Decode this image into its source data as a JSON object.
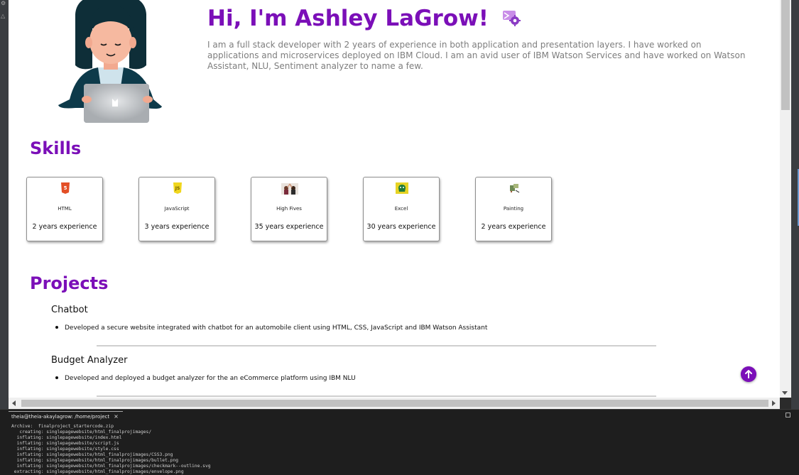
{
  "hero": {
    "title": "Hi, I'm Ashley LaGrow!",
    "description": "I am a full stack developer with 2 years of experience in both application and presentation layers. I have worked on applications and microservices deployed on IBM Cloud. I am an avid user of IBM Watson Services and have worked on Watson Assistant, NLU, Sentiment analyzer to name a few.",
    "title_icon": "envelope-gear-icon",
    "avatar_icon": "developer-avatar-illustration"
  },
  "skills": {
    "heading": "Skills",
    "items": [
      {
        "name": "HTML",
        "experience": "2 years experience",
        "icon": "html5-icon"
      },
      {
        "name": "JavaScript",
        "experience": "3 years experience",
        "icon": "javascript-icon"
      },
      {
        "name": "High Fives",
        "experience": "35 years experience",
        "icon": "high-fives-icon"
      },
      {
        "name": "Excel",
        "experience": "30 years experience",
        "icon": "excel-icon"
      },
      {
        "name": "Painting",
        "experience": "2 years experience",
        "icon": "painting-icon"
      }
    ]
  },
  "projects": {
    "heading": "Projects",
    "items": [
      {
        "title": "Chatbot",
        "bullet": "Developed a secure website integrated with chatbot for an automobile client using HTML, CSS, JavaScript and IBM Watson Assistant"
      },
      {
        "title": "Budget Analyzer",
        "bullet": "Developed and deployed a budget analyzer for the an eCommerce platform using IBM NLU"
      }
    ]
  },
  "terminal": {
    "tab_label": "theia@theia-akaylagrow: /home/project",
    "close_glyph": "×",
    "lines": [
      "Archive:  finalproject_startercode.zip",
      "   creating: singlepagewebsite/html_finalprojimages/",
      "  inflating: singlepagewebsite/index.html",
      "  inflating: singlepagewebsite/script.js",
      "  inflating: singlepagewebsite/style.css",
      "  inflating: singlepagewebsite/html_finalprojimages/CSS3.png",
      "  inflating: singlepagewebsite/html_finalprojimages/bullet.png",
      "  inflating: singlepagewebsite/html_finalprojimages/checkmark--outline.svg",
      " extracting: singlepagewebsite/html_finalprojimages/envelope.png"
    ]
  },
  "colors": {
    "accent": "#7b0fb8",
    "text_muted": "#7d7d7d",
    "terminal_bg": "#1e1e1e"
  }
}
